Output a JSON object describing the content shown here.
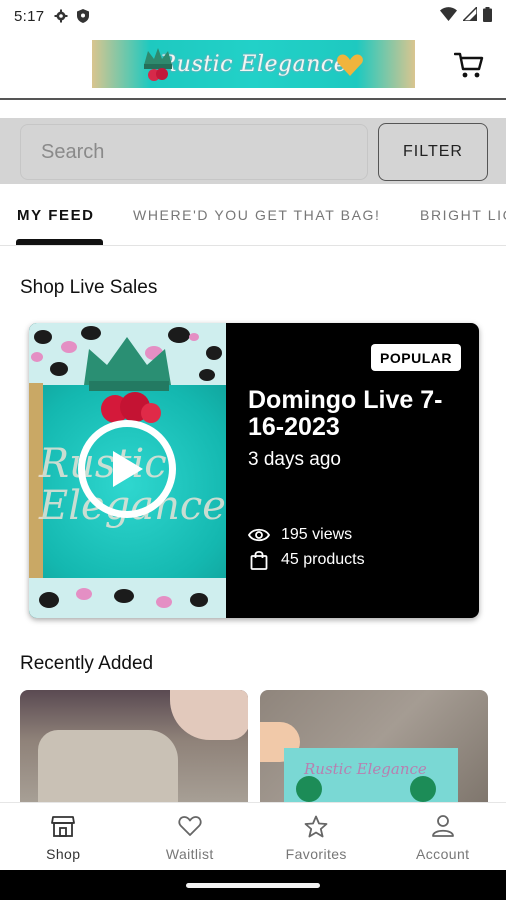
{
  "status_bar": {
    "time": "5:17"
  },
  "header": {
    "logo_text": "Rustic Elegance",
    "cart_icon": "cart-icon"
  },
  "search": {
    "placeholder": "Search",
    "filter_label": "FILTER"
  },
  "tabs": [
    {
      "label": "MY FEED",
      "active": true
    },
    {
      "label": "WHERE'D YOU GET THAT BAG!",
      "active": false
    },
    {
      "label": "BRIGHT LIG",
      "active": false
    }
  ],
  "live_sales": {
    "section_title": "Shop Live Sales",
    "card": {
      "badge": "POPULAR",
      "title": "Domingo Live 7-16-2023",
      "time_ago": "3 days ago",
      "views": "195 views",
      "products": "45 products",
      "thumb_text": "Rustic Elegance"
    }
  },
  "recently_added": {
    "section_title": "Recently Added",
    "items": [
      {
        "image_text": ""
      },
      {
        "image_text": "Rustic Elegance"
      }
    ]
  },
  "bottom_nav": [
    {
      "label": "Shop",
      "icon": "shop-icon",
      "active": true
    },
    {
      "label": "Waitlist",
      "icon": "heart-icon",
      "active": false
    },
    {
      "label": "Favorites",
      "icon": "star-icon",
      "active": false
    },
    {
      "label": "Account",
      "icon": "person-icon",
      "active": false
    }
  ],
  "colors": {
    "accent": "#000000",
    "brand_teal": "#1ec9c0",
    "background": "#ffffff",
    "search_bg": "#d4d4d4"
  }
}
